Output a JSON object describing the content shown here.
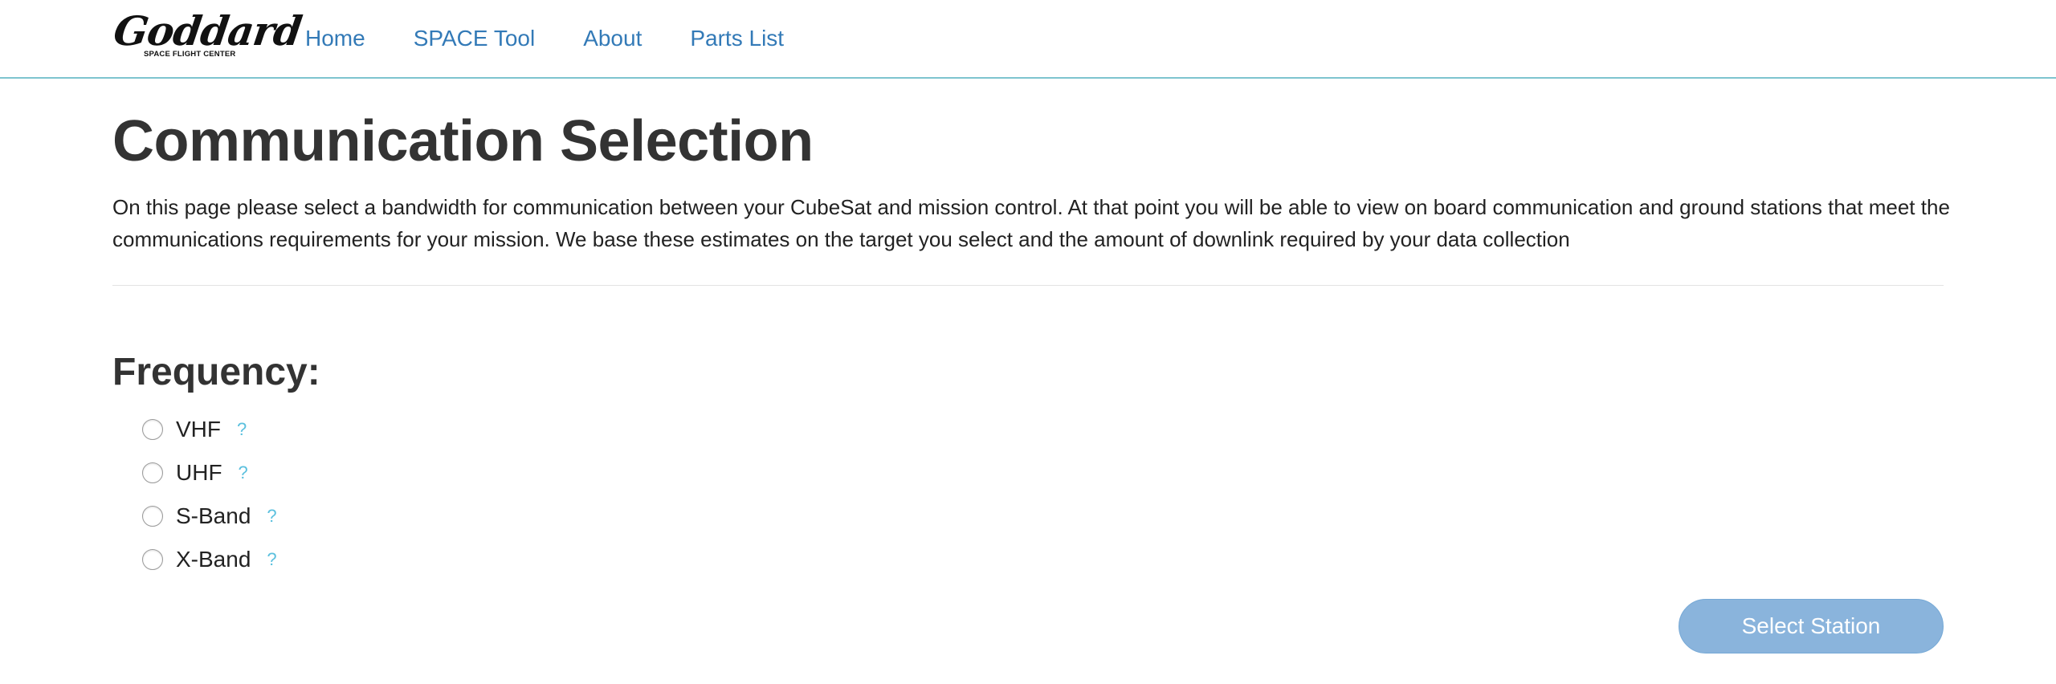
{
  "nav": {
    "logo": {
      "script": "Goddard",
      "subtitle": "SPACE FLIGHT CENTER"
    },
    "links": [
      "Home",
      "SPACE Tool",
      "About",
      "Parts List"
    ],
    "border_color": "#7ec4cf",
    "link_color": "#337ab7"
  },
  "page": {
    "title": "Communication Selection",
    "intro": "On this page please select a bandwidth for communication between your CubeSat and mission control. At that point you will be able to view on board communication and ground stations that meet the communications requirements for your mission. We base these estimates on the target you select and the amount of downlink required by your data collection"
  },
  "frequency": {
    "title": "Frequency:",
    "options": [
      {
        "label": "VHF",
        "help": "?",
        "selected": false
      },
      {
        "label": "UHF",
        "help": "?",
        "selected": false
      },
      {
        "label": "S-Band",
        "help": "?",
        "selected": false
      },
      {
        "label": "X-Band",
        "help": "?",
        "selected": false
      }
    ],
    "help_color": "#5bc0de"
  },
  "actions": {
    "select_station_label": "Select Station",
    "button_color": "#8ab4dc"
  }
}
